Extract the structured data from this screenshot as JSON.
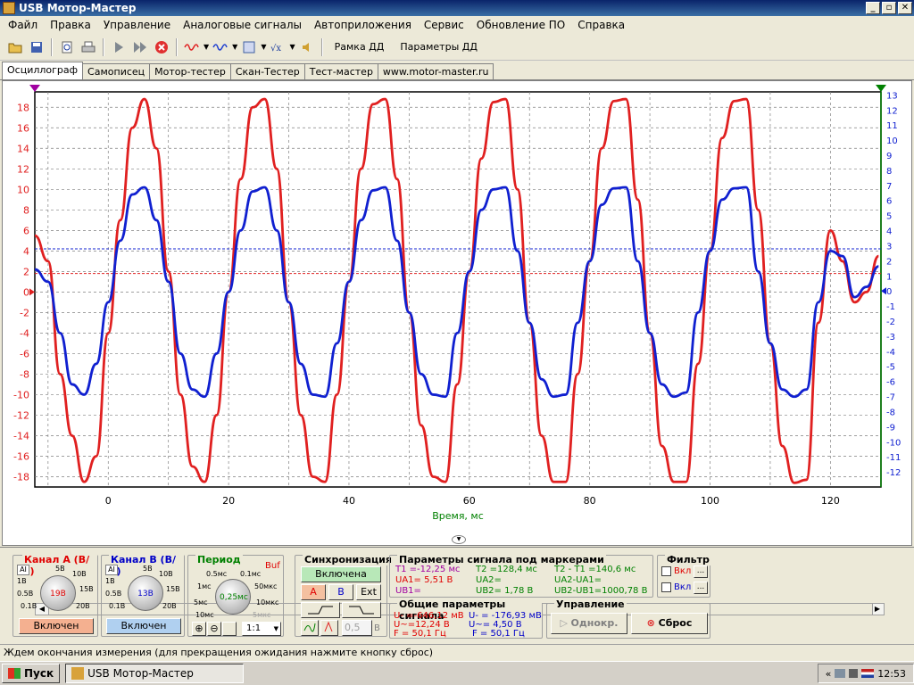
{
  "window": {
    "title": "USB Мотор-Мастер"
  },
  "menu": [
    "Файл",
    "Правка",
    "Управление",
    "Аналоговые сигналы",
    "Автоприложения",
    "Сервис",
    "Обновление ПО",
    "Справка"
  ],
  "toolbar": {
    "frame_btn": "Рамка ДД",
    "params_btn": "Параметры ДД"
  },
  "tabs": [
    "Осциллограф",
    "Самописец",
    "Мотор-тестер",
    "Скан-Тестер",
    "Тест-мастер",
    "www.motor-master.ru"
  ],
  "colors": {
    "channel_a": "#e02020",
    "channel_b": "#1020d0",
    "grid": "#808080"
  },
  "chart_data": {
    "type": "line",
    "xlabel": "Время, мс",
    "xlim": [
      -12.2,
      128.4
    ],
    "x_ticks": [
      0,
      20,
      40,
      60,
      80,
      100,
      120
    ],
    "left_axis": {
      "ylim": [
        -19,
        19.5
      ],
      "ticks": [
        18,
        16,
        14,
        12,
        10,
        8,
        6,
        4,
        2,
        0,
        -2,
        -4,
        -6,
        -8,
        -10,
        -12,
        -14,
        -16,
        -18
      ]
    },
    "right_axis": {
      "ylim": [
        -13,
        13.2
      ],
      "ticks": [
        13,
        12,
        11,
        10,
        9,
        8,
        7,
        6,
        5,
        4,
        3,
        2,
        1,
        0,
        -1,
        -2,
        -3,
        -4,
        -5,
        -6,
        -7,
        -8,
        -9,
        -10,
        -11,
        -12
      ]
    },
    "series": [
      {
        "x": [
          -12.2,
          -10,
          -8,
          -6,
          -4,
          -2,
          0,
          2,
          4,
          6,
          8,
          10,
          12,
          14,
          16,
          18,
          20,
          22,
          24,
          26,
          28,
          30,
          32,
          34,
          36,
          38,
          40,
          42,
          44,
          46,
          48,
          50,
          52,
          54,
          56,
          58,
          60,
          62,
          64,
          66,
          68,
          70,
          72,
          74,
          76,
          78,
          80,
          82,
          84,
          86,
          88,
          90,
          92,
          94,
          96,
          98,
          100,
          102,
          104,
          106,
          108,
          110,
          112,
          114,
          116,
          118,
          120,
          122,
          124,
          126,
          128
        ],
        "y": [
          5.5,
          3,
          -8,
          -14,
          -18.5,
          -16,
          -4,
          7,
          16,
          18.8,
          14,
          2,
          -10,
          -17,
          -18.5,
          -12,
          0,
          11,
          18,
          18.8,
          12,
          -1,
          -12,
          -18,
          -18.5,
          -10,
          1,
          12,
          18.3,
          18.8,
          11,
          -2,
          -13,
          -18,
          -18.5,
          -9,
          2,
          13,
          18.5,
          18.8,
          10,
          -3,
          -14,
          -18.5,
          -18.5,
          -8,
          3,
          14,
          18.6,
          18.8,
          9,
          -4,
          -15,
          -18.5,
          -18.5,
          -7,
          4,
          15,
          18.6,
          18.8,
          8,
          -5,
          -15,
          -18.6,
          -18.3,
          -3,
          6,
          3,
          -1,
          0,
          3.5
        ]
      },
      {
        "x": [
          -12.2,
          -10,
          -8,
          -6,
          -4,
          -2,
          0,
          2,
          4,
          6,
          8,
          10,
          12,
          14,
          16,
          18,
          20,
          22,
          24,
          26,
          28,
          30,
          32,
          34,
          36,
          38,
          40,
          42,
          44,
          46,
          48,
          50,
          52,
          54,
          56,
          58,
          60,
          62,
          64,
          66,
          68,
          70,
          72,
          74,
          76,
          78,
          80,
          82,
          84,
          86,
          88,
          90,
          92,
          94,
          96,
          98,
          100,
          102,
          104,
          106,
          108,
          110,
          112,
          114,
          116,
          118,
          120,
          122,
          124,
          126,
          128
        ],
        "y": [
          2.2,
          1,
          -4,
          -9,
          -10,
          -7,
          -1,
          5,
          9.5,
          10.2,
          7,
          1,
          -6,
          -9.5,
          -10.2,
          -6,
          0,
          6,
          9.8,
          10.2,
          6,
          -1,
          -7,
          -10,
          -10.2,
          -5,
          1,
          7,
          9.9,
          10.2,
          5,
          -2,
          -8,
          -10,
          -10.2,
          -4,
          2,
          8,
          10,
          10.2,
          4,
          -3,
          -8.5,
          -10.2,
          -10,
          -3,
          3,
          8.5,
          10.1,
          10.2,
          3,
          -4,
          -9,
          -10.2,
          -9.8,
          -2,
          4,
          9,
          10.1,
          10.2,
          2,
          -5,
          -9.5,
          -10.2,
          -9.5,
          -1,
          4,
          3.5,
          -0.5,
          0.5,
          2.5
        ]
      }
    ],
    "markers": [
      {
        "level": 1.8
      },
      {
        "level": 4.2
      }
    ]
  },
  "channel_a": {
    "title": "Канал А (В/э)",
    "ai_label": "AI",
    "scale_labels": [
      "5В",
      "10В",
      "15В",
      "20В",
      "0.5В",
      "1В",
      "0.1В"
    ],
    "value": "19В",
    "enable_btn": "Включен"
  },
  "channel_b": {
    "title": "Канал В (В/э)",
    "ai_label": "AI",
    "scale_labels": [
      "5В",
      "10В",
      "15В",
      "20В",
      "0.5В",
      "1В",
      "0.1В"
    ],
    "value": "13В",
    "enable_btn": "Включен"
  },
  "period": {
    "title": "Период",
    "buf": "Buf",
    "labels": [
      "0.5мс",
      "0.1мс",
      "1мс",
      "50мкс",
      "5мс",
      "10мкс",
      "10мс",
      "5мкс"
    ],
    "value": "0,25мс",
    "ratio": "1:1"
  },
  "sync": {
    "title": "Синхронизация",
    "enable_btn": "Включена",
    "a": "A",
    "b": "B",
    "ext": "Ext",
    "level": "0,5",
    "level_unit": "В"
  },
  "marker_params": {
    "title": "Параметры сигнала под маркерами",
    "t1": "T1 =-12,25 мс",
    "t2": "T2 =128,4 мс",
    "dt": "T2 - T1 =140,6 мс",
    "ua1": "UA1= 5,51 В",
    "ua2": "UA2=",
    "dua": "UA2-UA1=",
    "ub1": "UB1=",
    "ub2": "UB2= 1,78 В",
    "dub": "UB2-UB1=1000,78 В"
  },
  "general_params": {
    "title": "Общие параметры сигнала",
    "a_minus": "U- =-646,12 мВ",
    "a_rms": "U~=12,24 В",
    "a_f": "F = 50,1 Гц",
    "b_minus": "U- = -176,93 мВ",
    "b_rms": "U~= 4,50 В",
    "b_f": "F = 50,1 Гц"
  },
  "filter": {
    "title": "Фильтр",
    "on1": "Вкл",
    "on2": "Вкл",
    "dots": "..."
  },
  "control": {
    "title": "Управление",
    "single": "Однокр.",
    "reset": "Сброс"
  },
  "status": "Ждем окончания измерения (для прекращения ожидания нажмите кнопку сброс)",
  "taskbar": {
    "start": "Пуск",
    "task": "USB Мотор-Мастер",
    "time": "12:53"
  }
}
